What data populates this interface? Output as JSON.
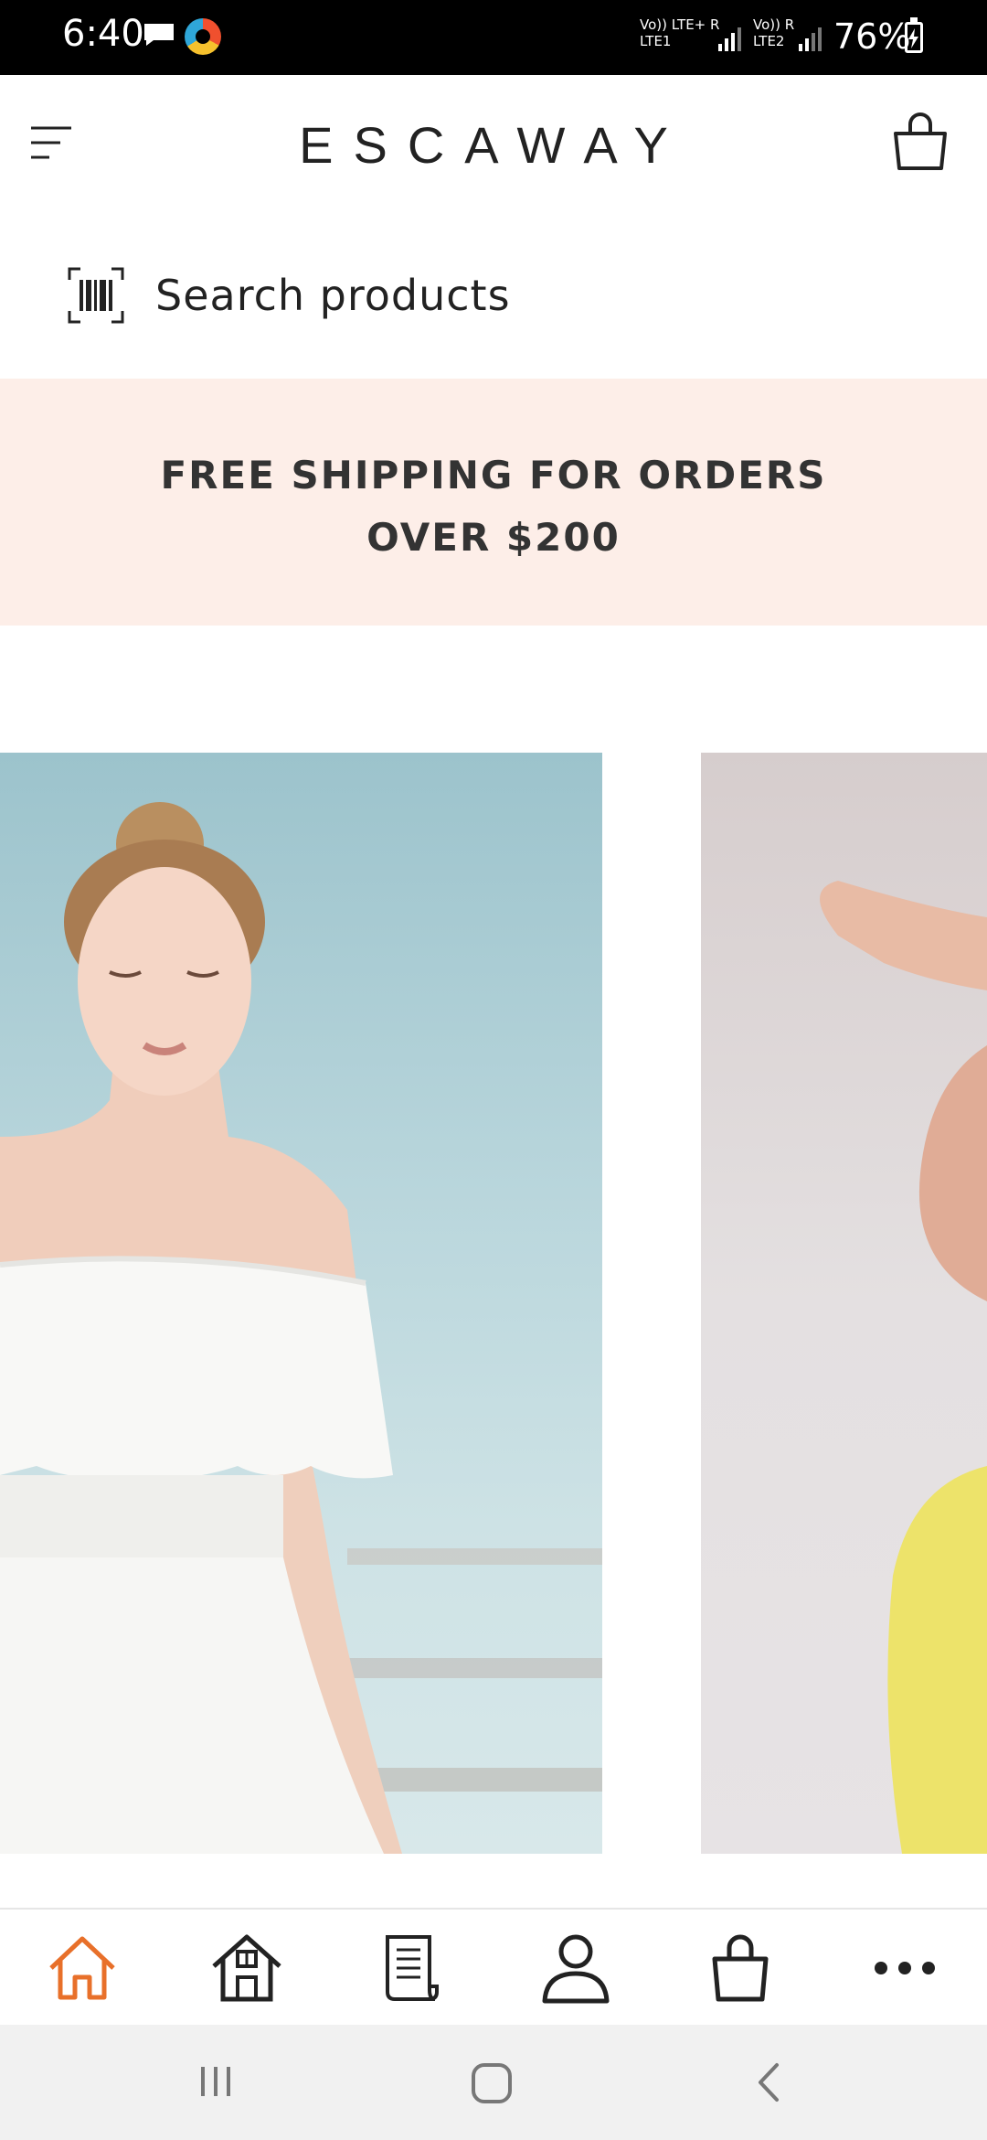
{
  "status_bar": {
    "time": "6:40",
    "sim1_top": "Vo)) LTE+ R",
    "sim1_bottom": "LTE1",
    "sim2_top": "Vo)) R",
    "sim2_bottom": "LTE2",
    "battery": "76%"
  },
  "header": {
    "brand": "ESCAWAY"
  },
  "search": {
    "placeholder": "Search products"
  },
  "banner": {
    "line1": "FREE SHIPPING FOR ORDERS",
    "line2": "OVER $200",
    "background": "#fdeee8"
  },
  "bottom_nav": {
    "items": [
      "home-outline-icon",
      "house-icon",
      "document-icon",
      "profile-icon",
      "shopping-bag-icon",
      "more-icon"
    ],
    "active_color": "#e8702a"
  }
}
